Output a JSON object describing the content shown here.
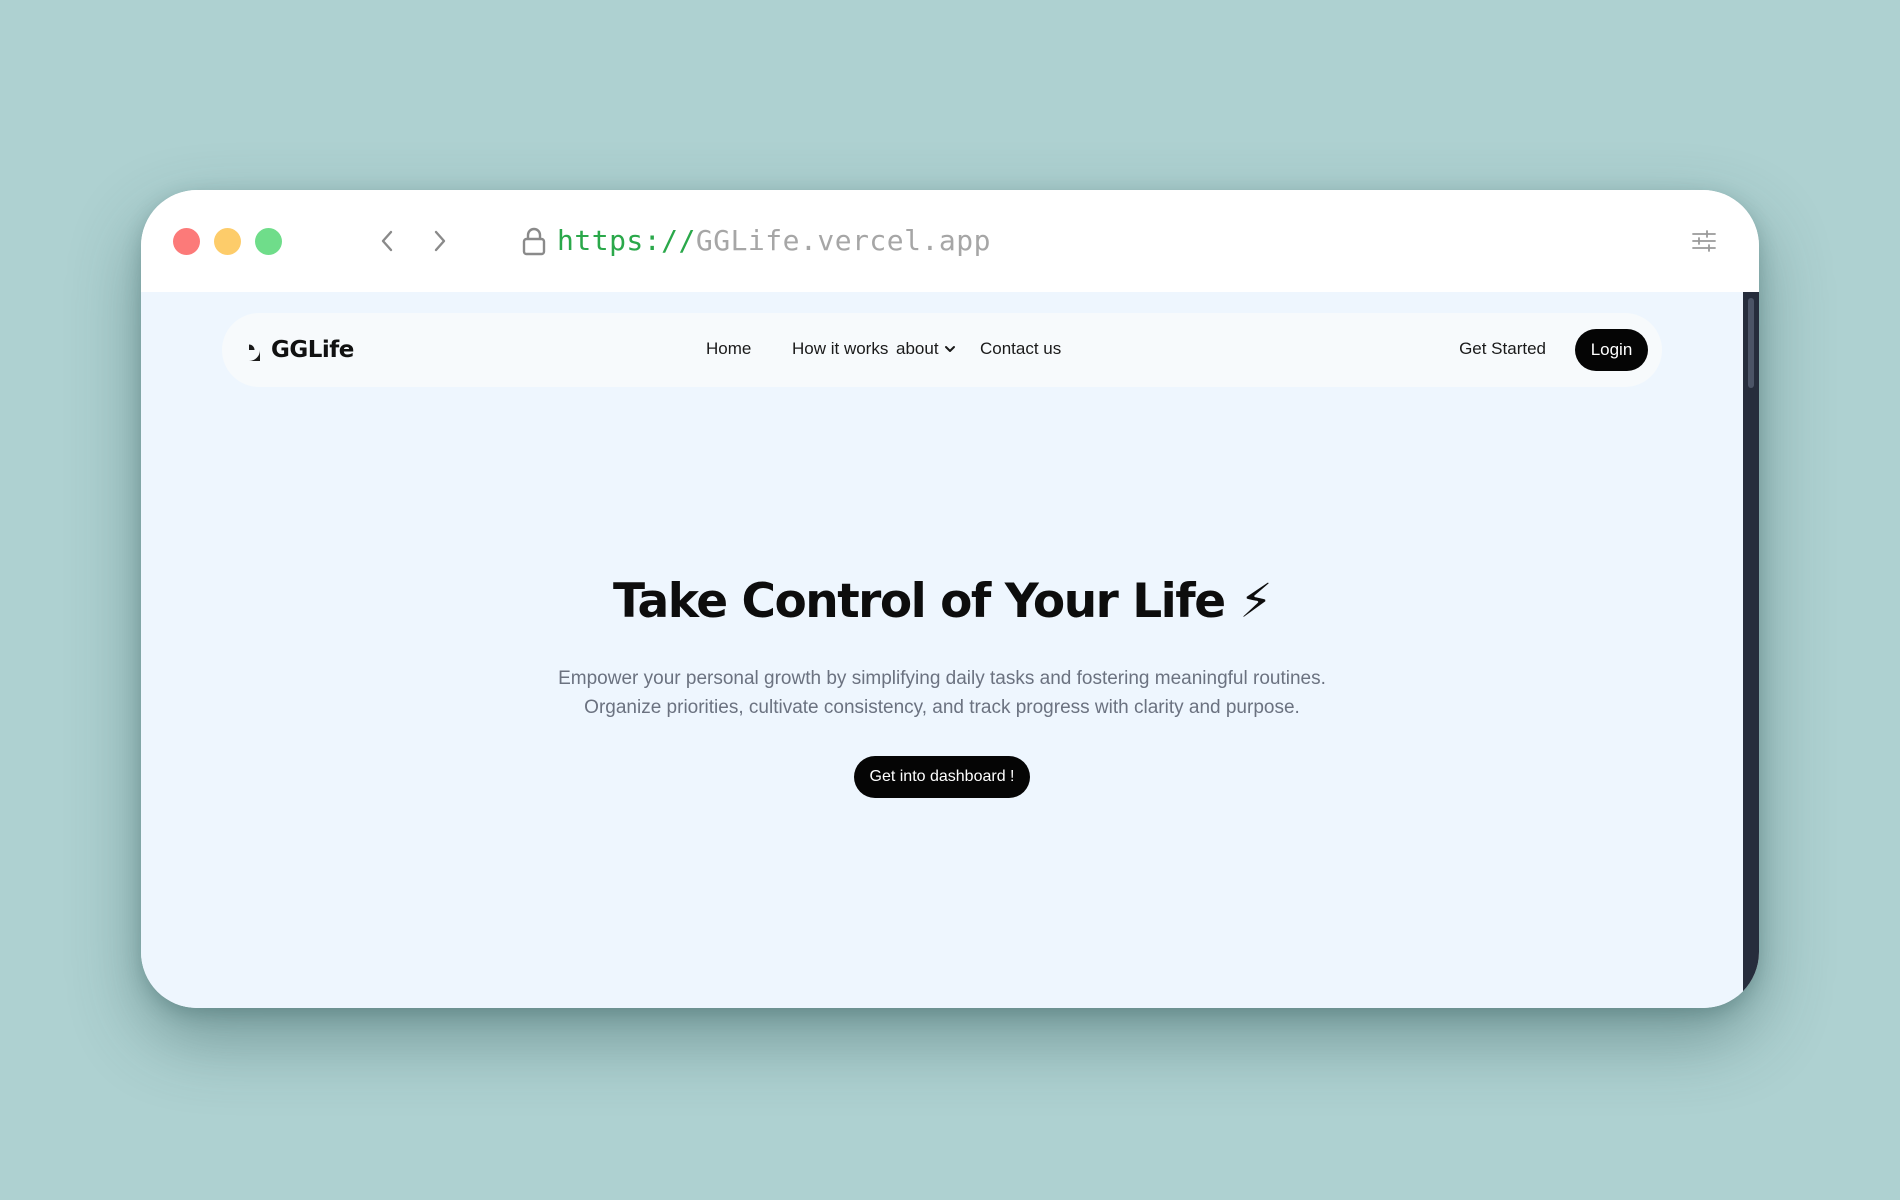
{
  "browser": {
    "url_protocol": "https://",
    "url_host": "GGLife.vercel.app",
    "traffic_lights": {
      "red": "#fc7a79",
      "yellow": "#fdcc6a",
      "green": "#6fdd8a"
    },
    "icons": [
      "lock-icon",
      "back-arrow-icon",
      "forward-arrow-icon",
      "settings-sliders-icon"
    ]
  },
  "site": {
    "brand": "GGLife",
    "nav": {
      "home": "Home",
      "how_it_works": "How it works",
      "about": "about",
      "contact": "Contact us"
    },
    "get_started": "Get Started",
    "login": "Login"
  },
  "hero": {
    "title": "Take Control of Your Life ⚡",
    "subtitle": "Empower your personal growth by simplifying daily tasks and fostering meaningful routines. Organize priorities, cultivate consistency, and track progress with clarity and purpose.",
    "cta": "Get into dashboard !"
  },
  "colors": {
    "background": "#aed1d1",
    "page_bg": "#eef6fe",
    "nav_bg": "#f7fafc",
    "button_bg": "#050505",
    "url_protocol": "#2aa84a",
    "url_host": "#a6a6a6",
    "subtitle": "#6b7280",
    "scrollbar": "#262d3c"
  }
}
